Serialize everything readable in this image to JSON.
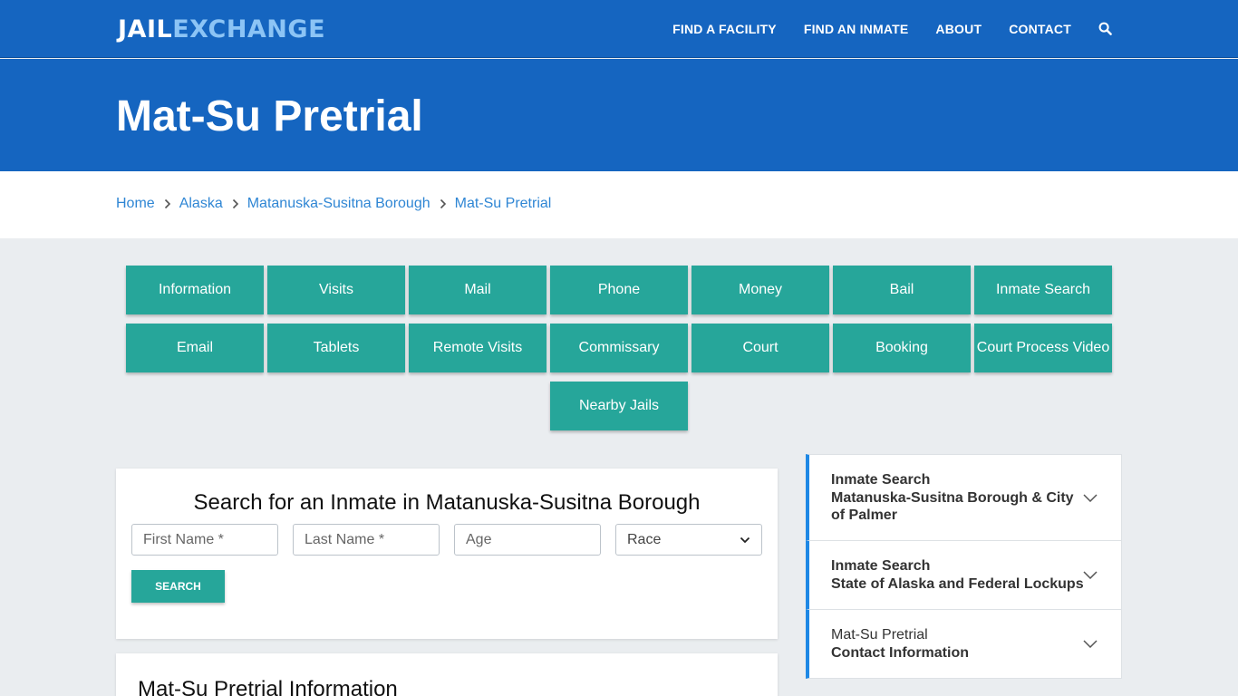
{
  "header": {
    "logo_part1": "JAIL",
    "logo_part2": "EXCHANGE",
    "nav": [
      "FIND A FACILITY",
      "FIND AN INMATE",
      "ABOUT",
      "CONTACT"
    ]
  },
  "hero": {
    "title": "Mat-Su Pretrial"
  },
  "breadcrumb": [
    "Home",
    "Alaska",
    "Matanuska-Susitna Borough",
    "Mat-Su Pretrial"
  ],
  "tabs": {
    "row1": [
      "Information",
      "Visits",
      "Mail",
      "Phone",
      "Money",
      "Bail",
      "Inmate Search"
    ],
    "row2": [
      "Email",
      "Tablets",
      "Remote Visits",
      "Commissary",
      "Court",
      "Booking",
      "Court Process Video"
    ],
    "row3": [
      "Nearby Jails"
    ]
  },
  "search": {
    "heading": "Search for an Inmate in Matanuska-Susitna Borough",
    "first_name_placeholder": "First Name *",
    "last_name_placeholder": "Last Name *",
    "age_placeholder": "Age",
    "race_selected": "Race",
    "button": "SEARCH"
  },
  "info": {
    "heading": "Mat-Su Pretrial Information"
  },
  "sidebar": [
    {
      "line1": "Inmate Search",
      "line2": "Matanuska-Susitna Borough & City of Palmer"
    },
    {
      "line1": "Inmate Search",
      "line2": "State of Alaska and Federal Lockups"
    },
    {
      "line1": "Mat-Su Pretrial",
      "line2": "Contact Information"
    }
  ],
  "colors": {
    "header_blue": "#1565c0",
    "teal": "#26a69a",
    "link_blue": "#2f86d4",
    "accent_blue": "#1e88e5"
  }
}
